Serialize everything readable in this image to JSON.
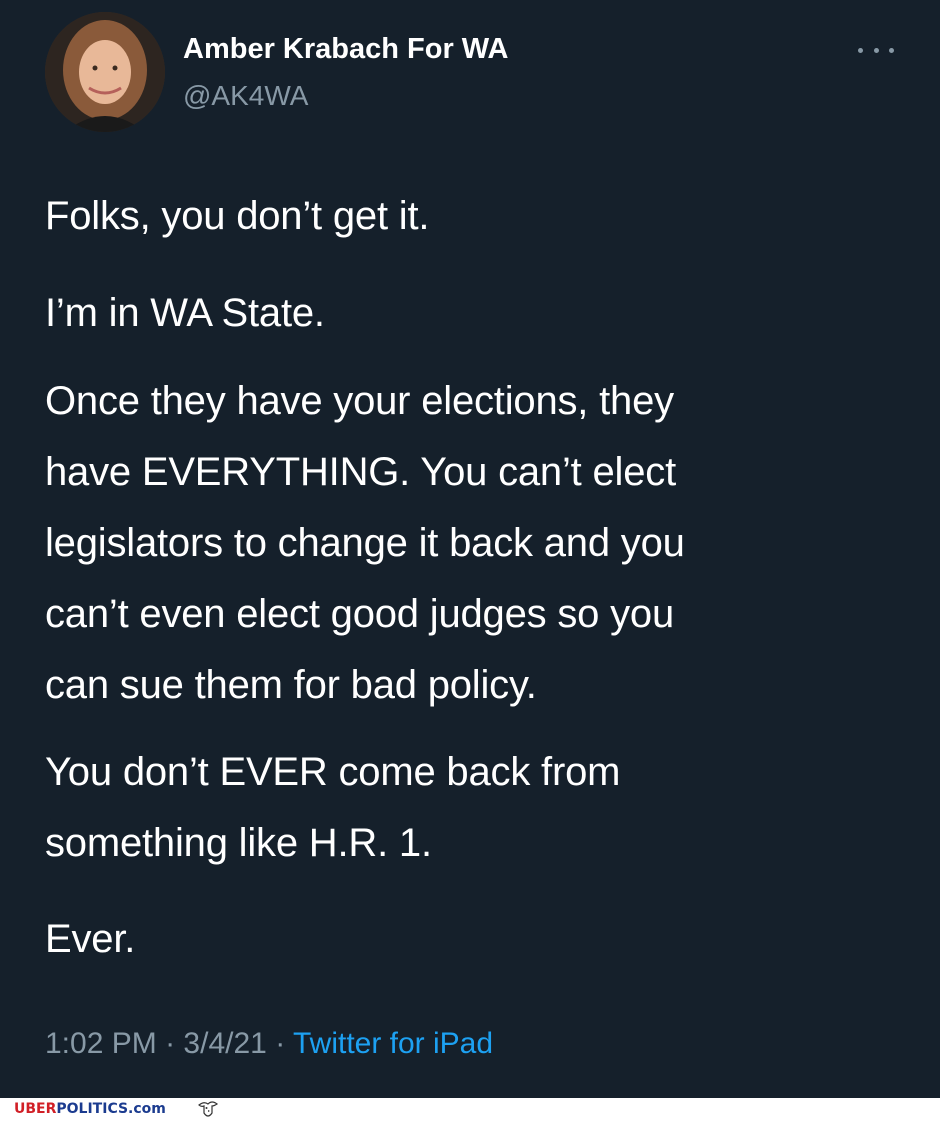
{
  "tweet": {
    "display_name": "Amber Krabach For WA",
    "handle": "@AK4WA",
    "more_icon": "more-options-icon",
    "paragraphs": {
      "p1": "Folks, you don’t get it.",
      "p2": "I’m in WA State.",
      "p3": "Once they have your elections, they\nhave EVERYTHING.  You can’t elect\nlegislators to change it back and you\ncan’t even elect good judges so you\ncan sue them for bad policy.",
      "p4": "You don’t EVER come back from\nsomething like H.R. 1.",
      "p5": "Ever."
    },
    "time": "1:02 PM",
    "date": "3/4/21",
    "separator": "·",
    "source": "Twitter for iPad"
  },
  "footer": {
    "brand_part1": "UBER",
    "brand_part2": "POLITICS.com"
  },
  "colors": {
    "background": "#15202b",
    "secondary_text": "#8899a6",
    "link": "#1da1f2",
    "brand_red": "#d11f26",
    "brand_blue": "#1b3b8f"
  }
}
